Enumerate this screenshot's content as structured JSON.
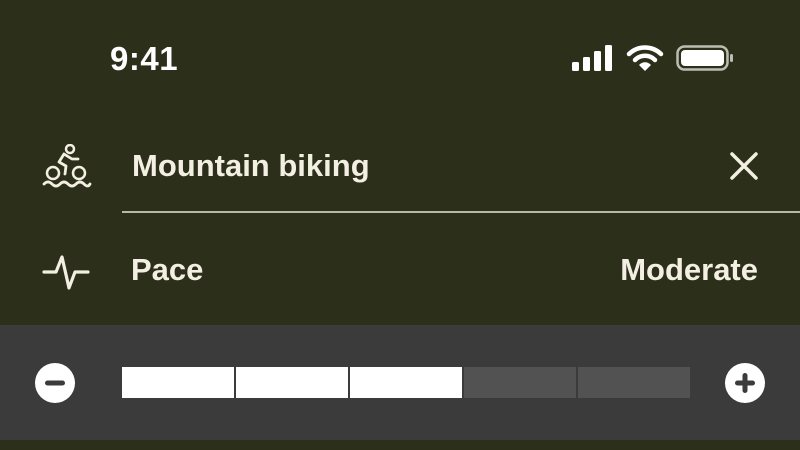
{
  "status_bar": {
    "time": "9:41",
    "icons": [
      "cellular-signal-icon",
      "wifi-icon",
      "battery-icon"
    ]
  },
  "activity": {
    "icon": "cycling-icon",
    "name": "Mountain biking",
    "close_icon": "close-icon"
  },
  "pace": {
    "icon": "activity-pulse-icon",
    "label": "Pace",
    "value": "Moderate"
  },
  "stepper": {
    "minus_icon": "minus-icon",
    "plus_icon": "plus-icon",
    "total_segments": 5,
    "filled_segments": 3
  },
  "colors": {
    "background": "#2c2f1a",
    "panel": "#3b3b3c",
    "text": "#f3efe2",
    "segment_filled": "#ffffff",
    "segment_empty": "#525252"
  }
}
